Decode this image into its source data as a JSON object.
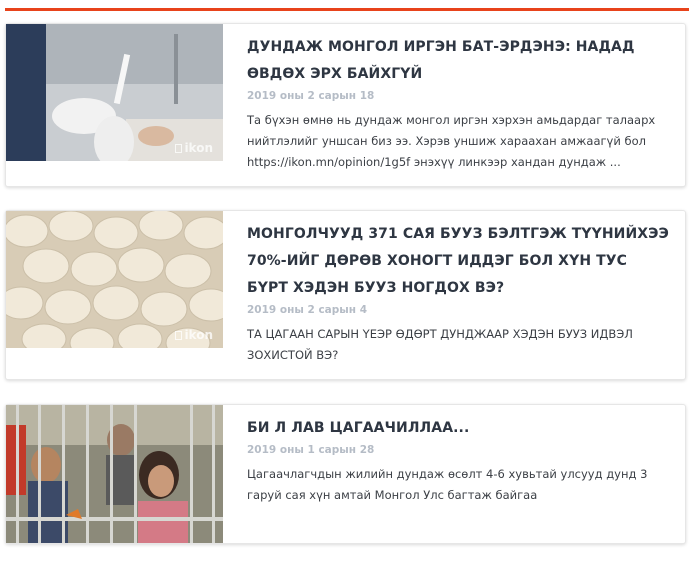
{
  "articles": [
    {
      "title": "ДУНДАЖ МОНГОЛ ИРГЭН БАТ-ЭРДЭНЭ: НАДАД ӨВДӨХ ЭРХ БАЙХГҮЙ",
      "date": "2019 оны 2 сарын 18",
      "excerpt": "Та бүхэн өмнө нь дундаж монгол иргэн хэрхэн амьдардаг талаарх нийтлэлийг уншсан биз ээ. Хэрэв уншиж хараахан амжаагүй бол https://ikon.mn/opinion/1g5f энэхүү линкээр хандан дундаж ...",
      "watermark": "ikon"
    },
    {
      "title": "МОНГОЛЧУУД 371 САЯ БУУЗ БЭЛТГЭЖ ТҮҮНИЙХЭЭ 70%-ИЙГ ДӨРӨВ ХОНОГТ ИДДЭГ БОЛ ХҮН ТУС БҮРТ ХЭДЭН БУУЗ НОГДОХ ВЭ?",
      "date": "2019 оны 2 сарын 4",
      "excerpt": "ТА ЦАГААН САРЫН ҮЕЭР ӨДӨРТ ДУНДЖААР ХЭДЭН БУУЗ ИДВЭЛ ЗОХИСТОЙ ВЭ?",
      "watermark": "ikon"
    },
    {
      "title": "БИ Л ЛАВ ЦАГААЧИЛЛАА...",
      "date": "2019 оны 1 сарын 28",
      "excerpt": "Цагаачлагчдын жилийн дундаж өсөлт 4-6 хувьтай улсууд дунд 3 гаруй сая хүн амтай Монгол Улс багтаж байгаа"
    }
  ],
  "colors": {
    "accent": "#e8431b",
    "title": "#2e3642",
    "date": "#b5bcc6"
  }
}
